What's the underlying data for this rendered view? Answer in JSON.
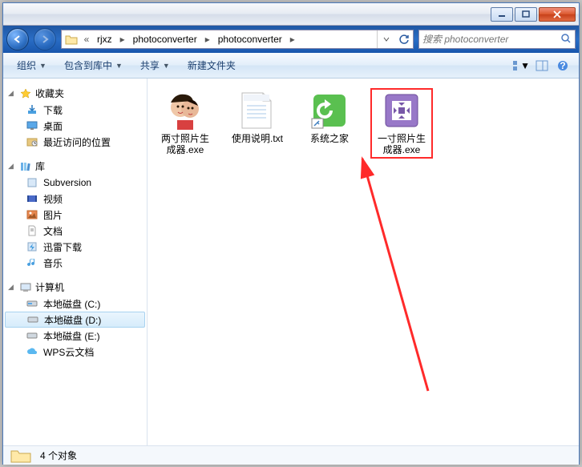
{
  "titlebar": {
    "min": "min",
    "max": "max",
    "close": "close"
  },
  "nav": {
    "back": "back",
    "forward": "forward",
    "crumbs": [
      "rjxz",
      "photoconverter",
      "photoconverter"
    ],
    "crumb_prefix": "«",
    "refresh": "refresh",
    "dropdown": "dropdown"
  },
  "search": {
    "placeholder": "搜索 photoconverter"
  },
  "toolbar": {
    "organize": "组织",
    "include": "包含到库中",
    "share": "共享",
    "newfolder": "新建文件夹",
    "view": "view",
    "preview": "preview",
    "help": "?"
  },
  "sidebar": {
    "favorites": {
      "label": "收藏夹",
      "items": [
        {
          "label": "下载",
          "icon": "download"
        },
        {
          "label": "桌面",
          "icon": "desktop"
        },
        {
          "label": "最近访问的位置",
          "icon": "recent"
        }
      ]
    },
    "library": {
      "label": "库",
      "items": [
        {
          "label": "Subversion",
          "icon": "svn"
        },
        {
          "label": "视频",
          "icon": "video"
        },
        {
          "label": "图片",
          "icon": "picture"
        },
        {
          "label": "文档",
          "icon": "document"
        },
        {
          "label": "迅雷下载",
          "icon": "thunder"
        },
        {
          "label": "音乐",
          "icon": "music"
        }
      ]
    },
    "computer": {
      "label": "计算机",
      "items": [
        {
          "label": "本地磁盘 (C:)",
          "icon": "drive"
        },
        {
          "label": "本地磁盘 (D:)",
          "icon": "drive",
          "selected": true
        },
        {
          "label": "本地磁盘 (E:)",
          "icon": "drive"
        },
        {
          "label": "WPS云文档",
          "icon": "cloud"
        }
      ]
    }
  },
  "files": [
    {
      "name": "两寸照片生成器.exe",
      "icon": "photo-couple"
    },
    {
      "name": "使用说明.txt",
      "icon": "txt"
    },
    {
      "name": "系统之家",
      "icon": "shortcut-ie"
    },
    {
      "name": "一寸照片生成器.exe",
      "icon": "photo-app",
      "highlight": true
    }
  ],
  "status": {
    "count": "4 个对象"
  }
}
